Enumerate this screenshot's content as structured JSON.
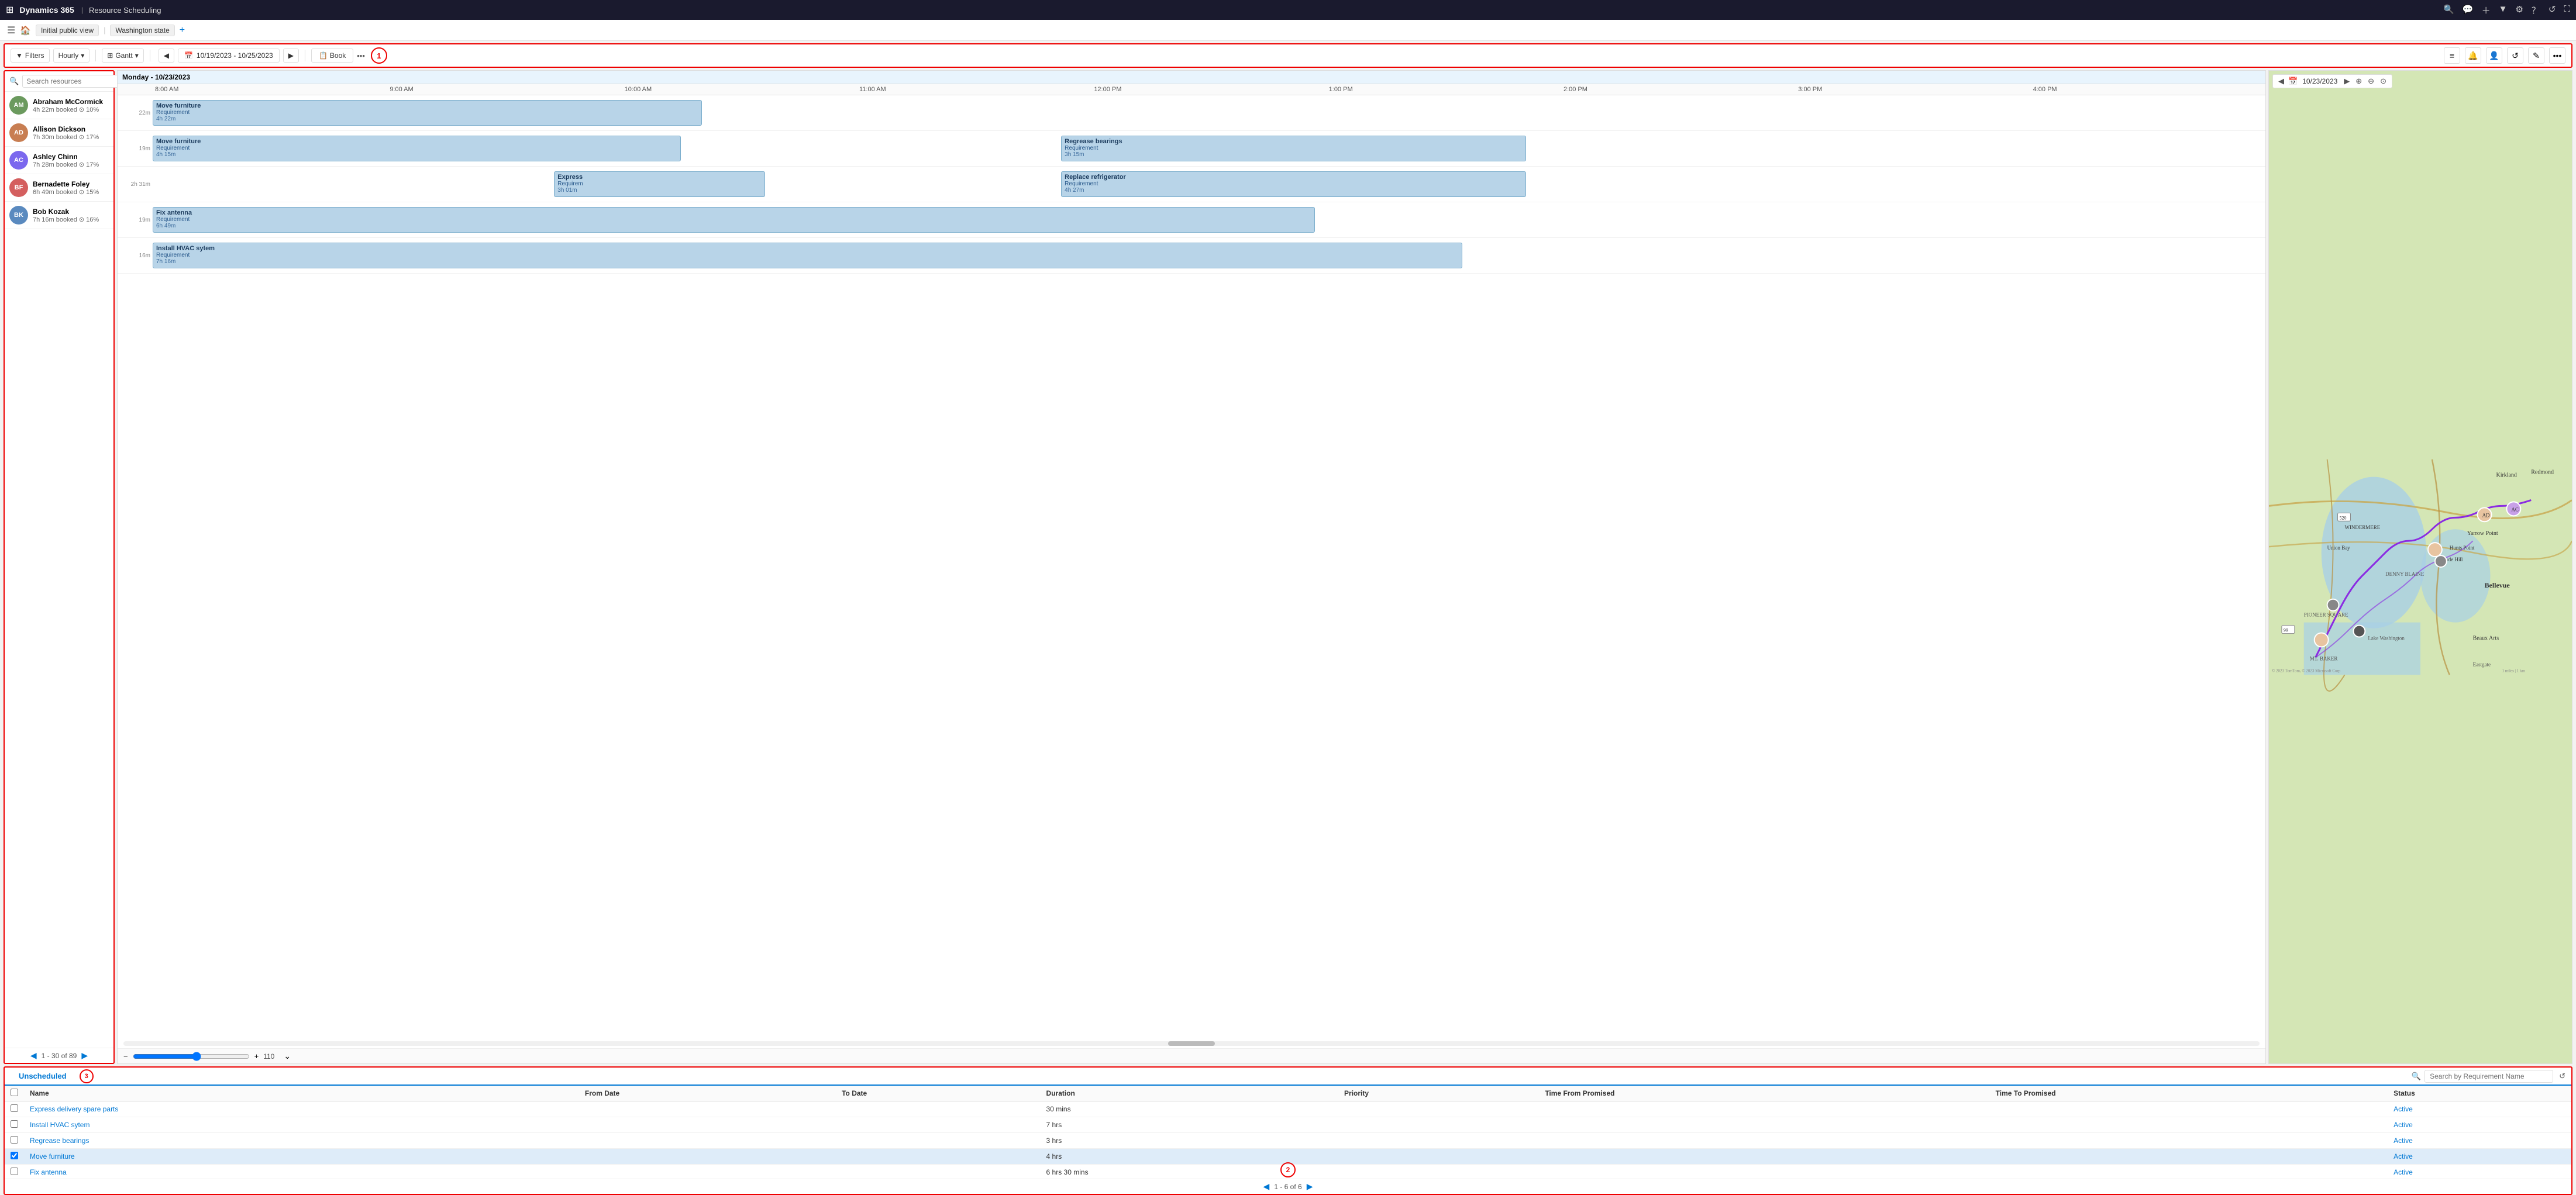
{
  "topnav": {
    "grid_icon": "⊞",
    "app": "Dynamics 365",
    "module": "Resource Scheduling",
    "icons": [
      "🔍",
      "💬",
      "＋",
      "▼",
      "⚙",
      "？",
      "↺",
      "⛶"
    ]
  },
  "viewbar": {
    "hamburger": "☰",
    "view1": "Initial public view",
    "separator": "|",
    "view2": "Washington state",
    "add": "+"
  },
  "toolbar": {
    "filters_label": "Filters",
    "hourly_label": "Hourly",
    "gantt_label": "Gantt",
    "date_range": "10/19/2023 - 10/25/2023",
    "book_label": "Book",
    "circle1": "1",
    "right_icons": [
      "📋",
      "🔔",
      "👤",
      "↺",
      "✎",
      "..."
    ]
  },
  "search": {
    "placeholder": "Search resources"
  },
  "resources": [
    {
      "name": "Abraham McCormick",
      "sub": "4h 22m booked",
      "pct": "10%",
      "initials": "AM",
      "av_class": "av-am"
    },
    {
      "name": "Allison Dickson",
      "sub": "7h 30m booked",
      "pct": "17%",
      "initials": "AD",
      "av_class": "av-ad"
    },
    {
      "name": "Ashley Chinn",
      "sub": "7h 28m booked",
      "pct": "17%",
      "initials": "AC",
      "av_class": "av-ac"
    },
    {
      "name": "Bernadette Foley",
      "sub": "6h 49m booked",
      "pct": "15%",
      "initials": "BF",
      "av_class": "av-bf"
    },
    {
      "name": "Bob Kozak",
      "sub": "7h 16m booked",
      "pct": "16%",
      "initials": "BK",
      "av_class": "av-bk"
    }
  ],
  "pagination": {
    "label": "1 - 30 of 89"
  },
  "gantt": {
    "header_date": "Monday - 10/23/2023",
    "times": [
      "8:00 AM",
      "9:00 AM",
      "10:00 AM",
      "11:00 AM",
      "12:00 PM",
      "1:00 PM",
      "2:00 PM",
      "3:00 PM",
      "4:00 PM"
    ],
    "rows": [
      {
        "row_label": "22m",
        "blocks": [
          {
            "title": "Move furniture",
            "sub": "Requirement",
            "time": "4h 22m",
            "left": "0%",
            "width": "26%",
            "color": "#b8d4e8"
          }
        ]
      },
      {
        "row_label": "19m",
        "blocks": [
          {
            "title": "Move furniture",
            "sub": "Requirement",
            "time": "4h 15m",
            "left": "0%",
            "width": "25%",
            "color": "#b8d4e8"
          },
          {
            "title": "Regrease bearings",
            "sub": "Requirement",
            "time": "3h 15m",
            "left": "43%",
            "width": "22%",
            "color": "#b8d4e8"
          }
        ]
      },
      {
        "row_label": "2h 31m",
        "blocks": [
          {
            "title": "Express",
            "sub": "Requirem",
            "time": "3h 01m",
            "left": "19%",
            "width": "10%",
            "color": "#b8d4e8"
          },
          {
            "title": "Replace refrigerator",
            "sub": "Requirement",
            "time": "4h 27m",
            "left": "43%",
            "width": "22%",
            "color": "#b8d4e8"
          }
        ]
      },
      {
        "row_label": "19m",
        "blocks": [
          {
            "title": "Fix antenna",
            "sub": "Requirement",
            "time": "6h 49m",
            "left": "0%",
            "width": "55%",
            "color": "#b8d4e8"
          }
        ]
      },
      {
        "row_label": "16m",
        "blocks": [
          {
            "title": "Install HVAC sytem",
            "sub": "Requirement",
            "time": "7h 16m",
            "left": "0%",
            "width": "62%",
            "color": "#b8d4e8"
          }
        ]
      }
    ]
  },
  "map": {
    "date": "10/23/2023",
    "zoom_level": "110"
  },
  "bottom": {
    "tab_label": "Unscheduled",
    "circle3": "3",
    "search_placeholder": "Search by Requirement Name",
    "columns": [
      "Name",
      "From Date",
      "To Date",
      "Duration",
      "Priority",
      "Time From Promised",
      "Time To Promised",
      "Status"
    ],
    "rows": [
      {
        "name": "Express delivery spare parts",
        "from_date": "",
        "to_date": "",
        "duration": "30 mins",
        "priority": "",
        "time_from": "",
        "time_to": "",
        "status": "Active",
        "selected": false
      },
      {
        "name": "Install HVAC sytem",
        "from_date": "",
        "to_date": "",
        "duration": "7 hrs",
        "priority": "",
        "time_from": "",
        "time_to": "",
        "status": "Active",
        "selected": false
      },
      {
        "name": "Regrease bearings",
        "from_date": "",
        "to_date": "",
        "duration": "3 hrs",
        "priority": "",
        "time_from": "",
        "time_to": "",
        "status": "Active",
        "selected": false
      },
      {
        "name": "Move furniture",
        "from_date": "",
        "to_date": "",
        "duration": "4 hrs",
        "priority": "",
        "time_from": "",
        "time_to": "",
        "status": "Active",
        "selected": true
      },
      {
        "name": "Fix antenna",
        "from_date": "",
        "to_date": "",
        "duration": "6 hrs 30 mins",
        "priority": "",
        "time_from": "",
        "time_to": "",
        "status": "Active",
        "selected": false
      }
    ],
    "footer": "1 - 6 of 6"
  }
}
